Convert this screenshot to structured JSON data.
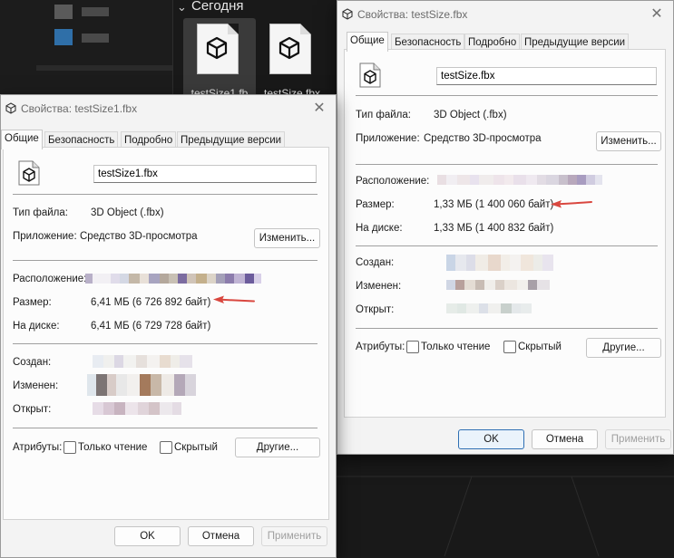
{
  "explorer": {
    "group_header": "Сегодня",
    "files": [
      {
        "name": "testSize1.fb",
        "selected": true
      },
      {
        "name": "testSize.fbx",
        "selected": false
      }
    ]
  },
  "dialog_left": {
    "title": "Свойства: testSize1.fbx",
    "tabs": [
      "Общие",
      "Безопасность",
      "Подробно",
      "Предыдущие версии"
    ],
    "file_name_value": "testSize1.fbx",
    "file_type_label": "Тип файла:",
    "file_type_value": "3D Object (.fbx)",
    "app_label": "Приложение:",
    "app_value": "Средство 3D-просмотра",
    "change_button": "Изменить...",
    "location_label": "Расположение:",
    "size_label": "Размер:",
    "size_value": "6,41 МБ (6 726 892 байт)",
    "disk_label": "На диске:",
    "disk_value": "6,41 МБ (6 729 728 байт)",
    "created_label": "Создан:",
    "modified_label": "Изменен:",
    "opened_label": "Открыт:",
    "attributes_label": "Атрибуты:",
    "readonly_label": "Только чтение",
    "hidden_label": "Скрытый",
    "other_button": "Другие...",
    "ok_button": "OK",
    "cancel_button": "Отмена",
    "apply_button": "Применить"
  },
  "dialog_right": {
    "title": "Свойства: testSize.fbx",
    "tabs": [
      "Общие",
      "Безопасность",
      "Подробно",
      "Предыдущие версии"
    ],
    "file_name_value": "testSize.fbx",
    "file_type_label": "Тип файла:",
    "file_type_value": "3D Object (.fbx)",
    "app_label": "Приложение:",
    "app_value": "Средство 3D-просмотра",
    "change_button": "Изменить...",
    "location_label": "Расположение:",
    "size_label": "Размер:",
    "size_value": "1,33 МБ (1 400 060 байт)",
    "disk_label": "На диске:",
    "disk_value": "1,33 МБ (1 400 832 байт)",
    "created_label": "Создан:",
    "modified_label": "Изменен:",
    "opened_label": "Открыт:",
    "attributes_label": "Атрибуты:",
    "readonly_label": "Только чтение",
    "hidden_label": "Скрытый",
    "other_button": "Другие...",
    "ok_button": "OK",
    "cancel_button": "Отмена",
    "apply_button": "Применить"
  },
  "colors": {
    "annotation_arrow": "#d9473f",
    "primary_button_border": "#2f6fb3"
  }
}
